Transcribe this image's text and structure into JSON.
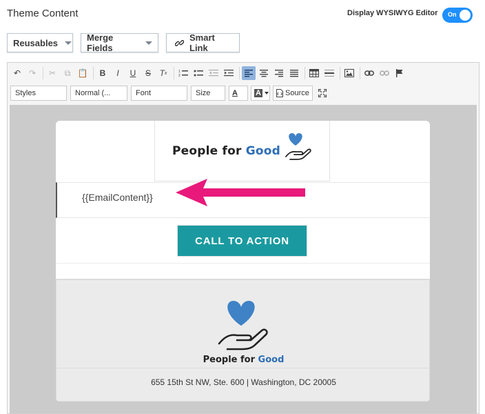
{
  "header": {
    "title": "Theme Content",
    "wysiwyg_label": "Display WYSIWYG Editor",
    "toggle_state": "On"
  },
  "buttons": {
    "reusables": "Reusables",
    "merge_fields": "Merge Fields",
    "smart_link": "Smart Link"
  },
  "toolbar": {
    "styles": "Styles",
    "format": "Normal (...",
    "font": "Font",
    "size": "Size",
    "source": "Source",
    "bold": "B",
    "italic": "I",
    "underline": "U",
    "strike": "S",
    "text_color_glyph": "A",
    "bg_color_glyph": "A"
  },
  "email": {
    "brand_main": "People for ",
    "brand_accent": "Good",
    "content_placeholder": "{{EmailContent}}",
    "cta_label": "CALL TO ACTION",
    "footer_brand_main": "People for ",
    "footer_brand_accent": "Good",
    "address": "655 15th St NW, Ste. 600 | Washington, DC 20005"
  },
  "colors": {
    "toggle": "#1e90ff",
    "cta": "#1a9aa0",
    "heart": "#3f82c6",
    "arrow": "#e8197b",
    "brand_accent": "#2c6db5"
  }
}
